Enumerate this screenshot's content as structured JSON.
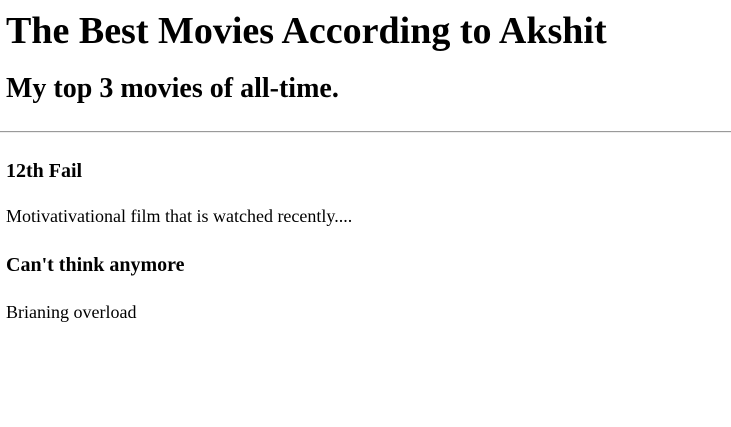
{
  "page": {
    "title": "The Best Movies According to Akshit",
    "subtitle": "My top 3 movies of all-time."
  },
  "movies": [
    {
      "title": "12th Fail",
      "description": "Motivativational film that is watched recently...."
    },
    {
      "title": "Can't think anymore",
      "description": "Brianing overload"
    }
  ]
}
